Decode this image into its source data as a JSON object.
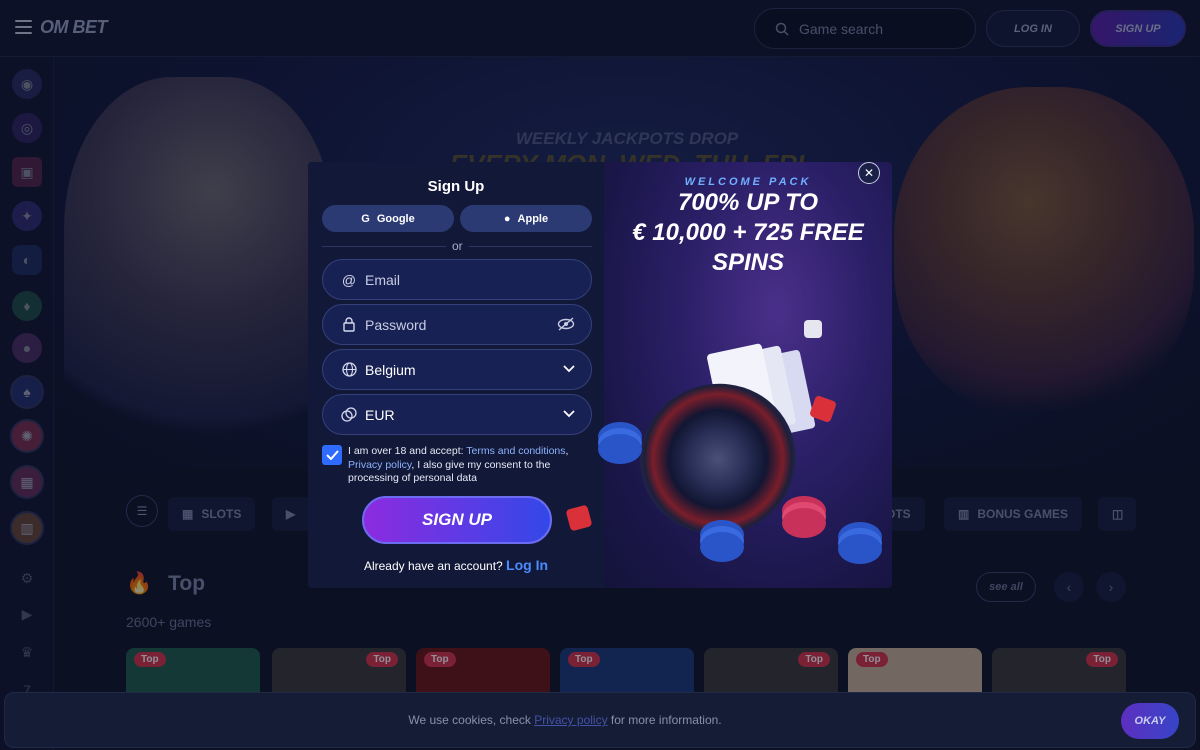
{
  "topbar": {
    "logo": "OM BET",
    "search_placeholder": "Game search",
    "login_label": "LOG IN",
    "signup_label": "SIGN UP"
  },
  "sidebar": {
    "icons": [
      "globe-icon",
      "target-icon",
      "chest-icon",
      "magic-icon",
      "controller-icon",
      "fruit-icon",
      "cupcake-icon",
      "poker-chip-icon",
      "wheel-icon",
      "gift-icon",
      "tournament-icon",
      "settings-icon",
      "video-icon",
      "vip-icon",
      "seven-icon"
    ]
  },
  "hero": {
    "line1": "WEEKLY JACKPOTS DROP",
    "line2": "EVERY MON, WED, THU, FRI"
  },
  "categories": {
    "items": [
      {
        "label": "SLOTS",
        "icon": "slot-icon"
      },
      {
        "label": "",
        "icon": "video-icon"
      },
      {
        "label": "OTS",
        "icon": ""
      },
      {
        "label": "BONUS GAMES",
        "icon": "bonus-icon"
      },
      {
        "label": "",
        "icon": "table-icon"
      }
    ]
  },
  "top_section": {
    "title": "Top",
    "count": "2600+ games",
    "see_all": "see all"
  },
  "tiles": [
    {
      "badge": "Top",
      "badge_side": "left",
      "color": "#1c5e4a"
    },
    {
      "badge": "Top",
      "badge_side": "right",
      "color": "#3a3a3a"
    },
    {
      "badge": "Top",
      "badge_side": "left",
      "color": "#6a1414"
    },
    {
      "badge": "Top",
      "badge_side": "left",
      "color": "#1a3a7a"
    },
    {
      "badge": "Top",
      "badge_side": "right",
      "color": "#3a3a3a"
    },
    {
      "badge": "Top",
      "badge_side": "left",
      "color": "#c9b39a"
    },
    {
      "badge": "Top",
      "badge_side": "right",
      "color": "#3a3a3a"
    }
  ],
  "cookie": {
    "text_before": "We use cookies, check ",
    "link": "Privacy policy",
    "text_after": " for more information.",
    "okay": "OKAY"
  },
  "modal": {
    "title": "Sign Up",
    "google": "Google",
    "apple": "Apple",
    "or": "or",
    "email_placeholder": "Email",
    "password_placeholder": "Password",
    "country": "Belgium",
    "currency": "EUR",
    "terms_prefix": "I am over 18 and accept: ",
    "terms_link": "Terms and conditions",
    "terms_comma": ",",
    "privacy_link": "Privacy policy",
    "terms_suffix": ", I also give my consent to the processing of personal data",
    "terms_checked": true,
    "signup_button": "SIGN UP",
    "already_text": "Already have an account? ",
    "login_link": "Log In",
    "welcome_pack": "WELCOME PACK",
    "offer_line1": "700% UP TO",
    "offer_line2": "€ 10,000 + 725 FREE",
    "offer_line3": "SPINS",
    "colors": {
      "accent_blue": "#2f6bff",
      "signup_gradient_start": "#8d2be0",
      "signup_gradient_end": "#3348e8"
    }
  }
}
